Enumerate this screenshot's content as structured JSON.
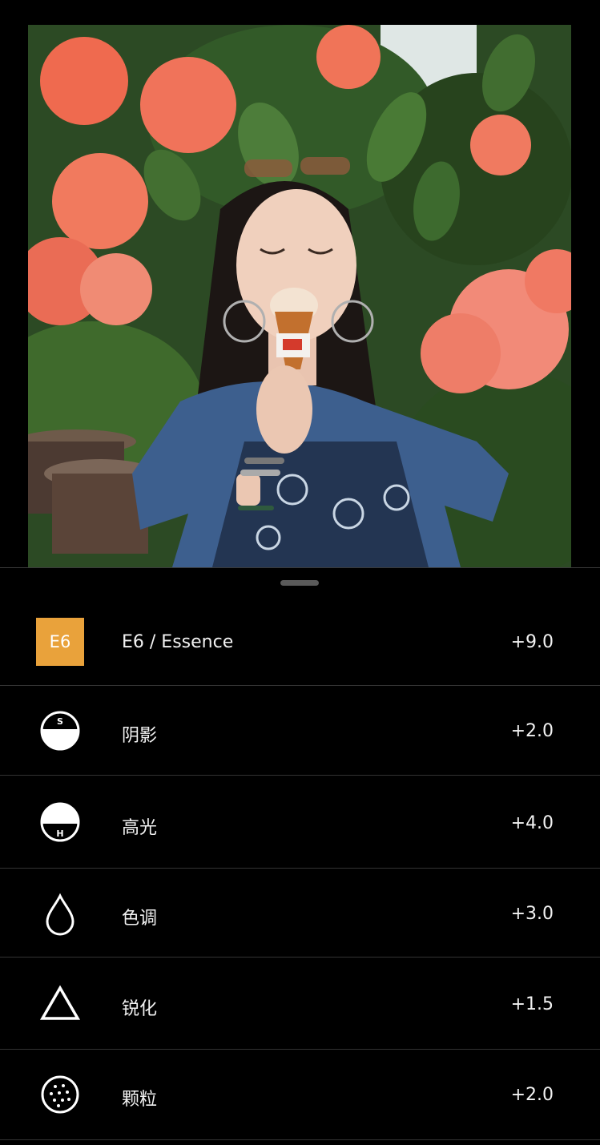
{
  "photo": {
    "description_icon": "photo-preview"
  },
  "adjustments": [
    {
      "id": "preset",
      "badge": "E6",
      "label": "E6 / Essence",
      "value": "+9.0",
      "icon": "preset-badge"
    },
    {
      "id": "shadows",
      "label": "阴影",
      "value": "+2.0",
      "icon": "shadows-icon",
      "icon_letter": "S"
    },
    {
      "id": "highlights",
      "label": "高光",
      "value": "+4.0",
      "icon": "highlights-icon",
      "icon_letter": "H"
    },
    {
      "id": "tint",
      "label": "色调",
      "value": "+3.0",
      "icon": "drop-icon"
    },
    {
      "id": "sharpen",
      "label": "锐化",
      "value": "+1.5",
      "icon": "triangle-icon"
    },
    {
      "id": "grain",
      "label": "颗粒",
      "value": "+2.0",
      "icon": "grain-icon"
    }
  ],
  "colors": {
    "accent": "#e9a23b",
    "background": "#000000",
    "divider": "#333333"
  }
}
